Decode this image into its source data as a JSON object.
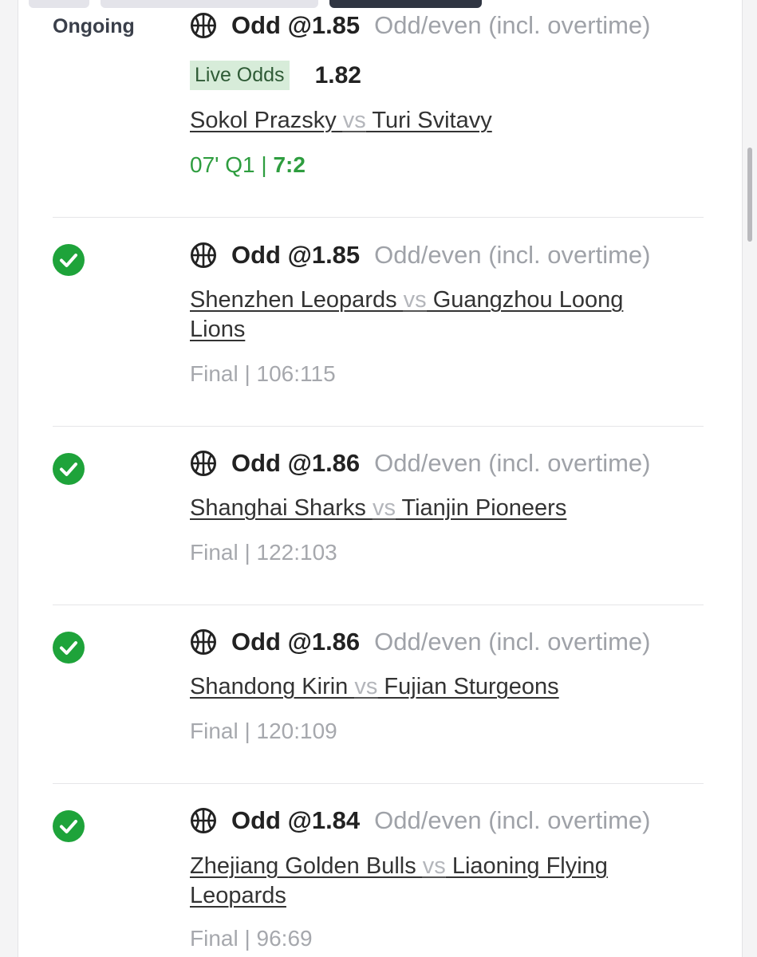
{
  "colors": {
    "check_green": "#1ea33a",
    "live_score_green": "#2e9d3f",
    "market_gray": "#9fa2a8",
    "live_badge_bg": "#d7ecd9"
  },
  "icons": {
    "sport": "basketball-icon",
    "settled": "check-circle-icon"
  },
  "bets": [
    {
      "status": "Ongoing",
      "odd": "Odd @1.85",
      "market": "Odd/even (incl. overtime)",
      "live_label": "Live Odds",
      "live_odds": "1.82",
      "home": "Sokol Prazsky ",
      "vs": "vs",
      "away": " Turi Svitavy",
      "score_prefix": "07' Q1 | ",
      "score_value": "7:2"
    },
    {
      "odd": "Odd @1.85",
      "market": "Odd/even (incl. overtime)",
      "home": "Shenzhen Leopards ",
      "vs": "vs",
      "away": " Guangzhou Loong Lions",
      "score": "Final | 106:115"
    },
    {
      "odd": "Odd @1.86",
      "market": "Odd/even (incl. overtime)",
      "home": "Shanghai Sharks ",
      "vs": "vs",
      "away": " Tianjin Pioneers",
      "score": "Final | 122:103"
    },
    {
      "odd": "Odd @1.86",
      "market": "Odd/even (incl. overtime)",
      "home": "Shandong Kirin ",
      "vs": "vs",
      "away": " Fujian Sturgeons",
      "score": "Final | 120:109"
    },
    {
      "odd": "Odd @1.84",
      "market": "Odd/even (incl. overtime)",
      "home": "Zhejiang Golden Bulls ",
      "vs": "vs",
      "away": " Liaoning Flying Leopards",
      "score": "Final | 96:69"
    }
  ]
}
